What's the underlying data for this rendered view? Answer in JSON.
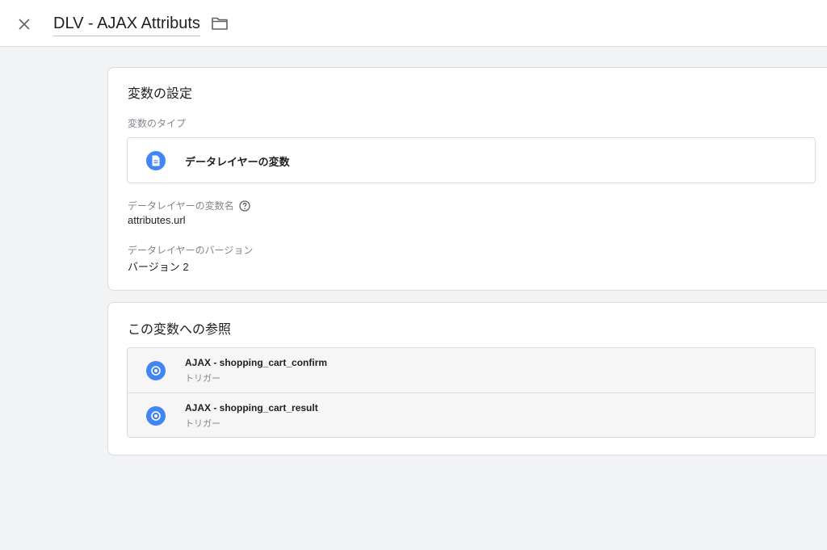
{
  "header": {
    "title": "DLV - AJAX Attributs",
    "close_icon": "close-icon",
    "folder_icon": "folder-icon"
  },
  "config": {
    "title": "変数の設定",
    "type_label": "変数のタイプ",
    "type_value": "データレイヤーの変数",
    "type_icon": "document-icon",
    "name_label": "データレイヤーの変数名",
    "name_value": "attributes.url",
    "version_label": "データレイヤーのバージョン",
    "version_value": "バージョン 2"
  },
  "references": {
    "title": "この変数への参照",
    "items": [
      {
        "name": "AJAX - shopping_cart_confirm",
        "type": "トリガー",
        "icon": "trigger-icon"
      },
      {
        "name": "AJAX - shopping_cart_result",
        "type": "トリガー",
        "icon": "trigger-icon"
      }
    ]
  },
  "colors": {
    "accent": "#4285f4",
    "background": "#f1f3f4",
    "card": "#ffffff",
    "border": "#dadce0"
  }
}
